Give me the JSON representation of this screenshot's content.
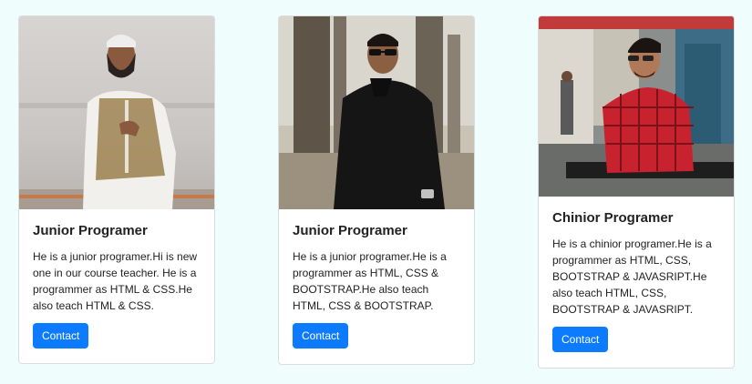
{
  "cards": [
    {
      "photo": "photo of man in white kurta and patterned vest",
      "title": "Junior Programer",
      "text": "He is a junior programer.Hi is new one in our course teacher. He is a programmer as HTML & CSS.He also teach HTML & CSS.",
      "button": "Contact"
    },
    {
      "photo": "photo of man in black shirt with sunglasses",
      "title": "Junior Programer",
      "text": "He is a junior programer.He is a programmer as HTML, CSS & BOOTSTRAP.He also teach HTML, CSS & BOOTSTRAP.",
      "button": "Contact"
    },
    {
      "photo": "photo of man in red checked shirt with sunglasses",
      "title": "Chinior Programer",
      "text": "He is a chinior programer.He is a programmer as HTML, CSS, BOOTSTRAP & JAVASRIPT.He also teach HTML, CSS, BOOTSTRAP & JAVASRIPT.",
      "button": "Contact"
    }
  ],
  "colors": {
    "page_bg": "#f0fdfd",
    "button": "#0d7bff"
  }
}
